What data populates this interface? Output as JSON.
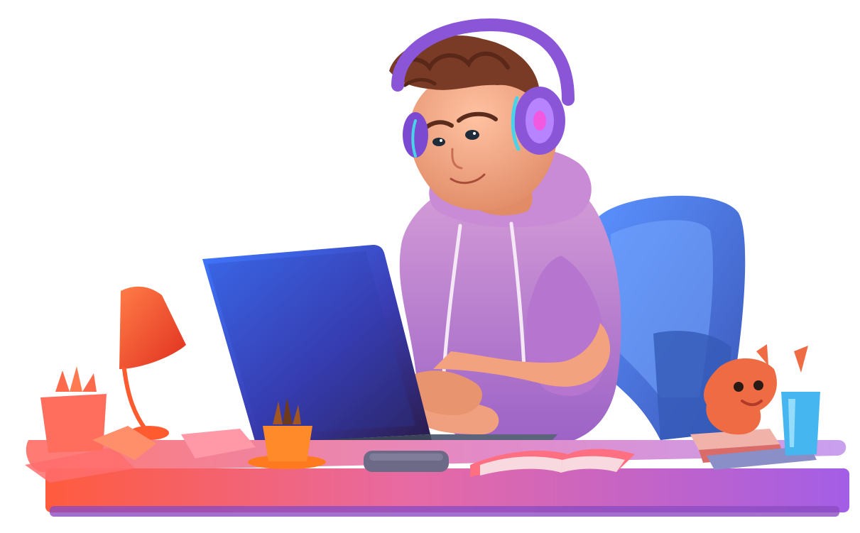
{
  "scene": {
    "subject": "person-at-desk",
    "icons": [
      "headphones-icon",
      "laptop-icon",
      "desk-lamp-icon",
      "plant-pot-icon",
      "coffee-cup-icon",
      "open-book-icon",
      "plush-toy-icon",
      "mouse-icon",
      "office-chair-icon"
    ]
  },
  "colors": {
    "background": "#ffffff",
    "desk_top": "#e88aa6",
    "desk_front_left": "#ff6a4d",
    "desk_front_right": "#b36ee6",
    "hoodie": "#c98ad6",
    "hoodie_shadow": "#a765be",
    "skin": "#f2a27e",
    "skin_shadow": "#d98562",
    "hair": "#7a3b26",
    "headphones": "#8b55d8",
    "headphones_light": "#49d3e8",
    "chair": "#4f86e6",
    "chair_shadow": "#3f63c4",
    "laptop_screen": "#3c55e6",
    "laptop_screen_dark": "#3b1f6b",
    "lamp": "#ff4f2e",
    "plant_pot": "#ff6d5d",
    "cup": "#ff8a2a",
    "book": "#ff6f82",
    "toy": "#ee6b44",
    "glass": "#45b6f0"
  }
}
